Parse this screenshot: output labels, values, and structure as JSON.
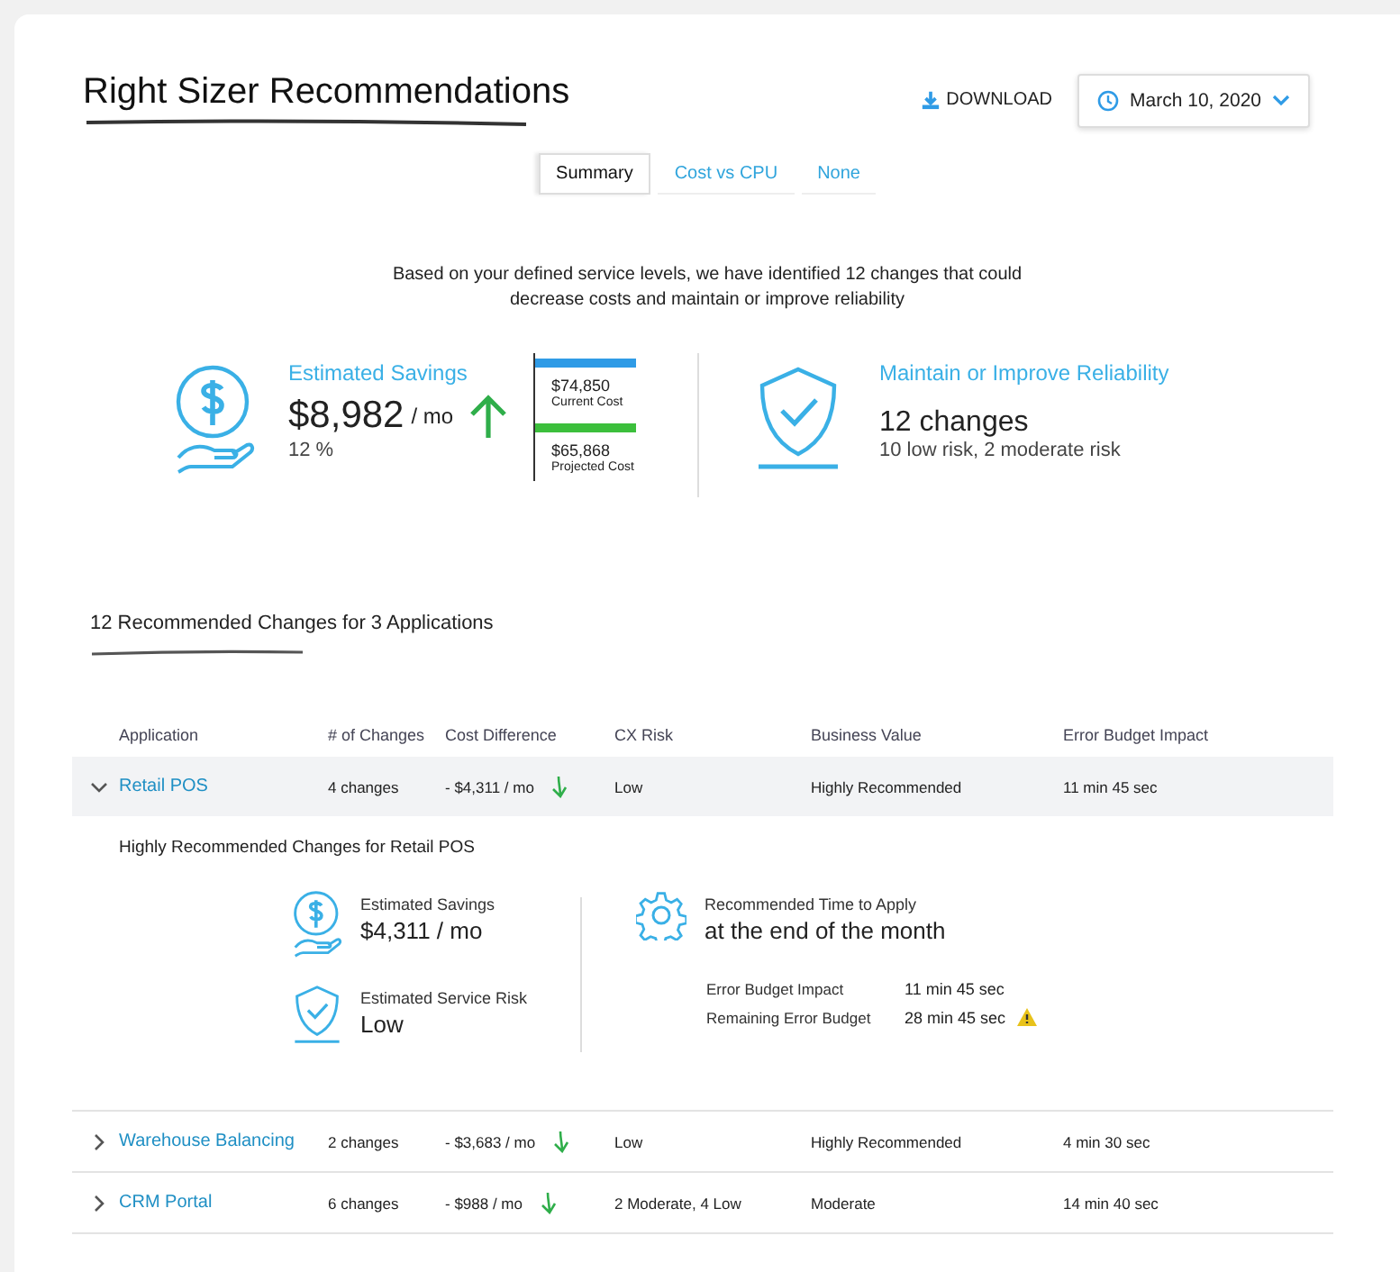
{
  "title": "Right Sizer Recommendations",
  "download": "DOWNLOAD",
  "date": "March 10, 2020",
  "tabs": [
    {
      "label": "Summary",
      "selected": true
    },
    {
      "label": "Cost vs CPU",
      "selected": false
    },
    {
      "label": "None",
      "selected": false
    }
  ],
  "intro": "Based on your defined service levels, we have identified 12 changes that could decrease costs and maintain or improve reliability",
  "savings": {
    "label": "Estimated Savings",
    "amount": "$8,982",
    "unit": "/ mo",
    "percent": "12 %"
  },
  "costs": [
    {
      "value": "$74,850",
      "label": "Current Cost",
      "color": "#2f9be6"
    },
    {
      "value": "$65,868",
      "label": "Projected Cost",
      "color": "#3cbf3c"
    }
  ],
  "reliability": {
    "label": "Maintain or Improve Reliability",
    "count": "12 changes",
    "detail": "10 low risk, 2 moderate risk"
  },
  "section_title": "12 Recommended Changes for 3 Applications",
  "columns": [
    "Application",
    "# of Changes",
    "Cost Difference",
    "CX Risk",
    "Business Value",
    "Error Budget Impact"
  ],
  "rows": [
    {
      "app": "Retail POS",
      "changes": "4 changes",
      "cost": "- $4,311 / mo",
      "risk": "Low",
      "value": "Highly Recommended",
      "impact": "11 min 45 sec",
      "expanded": true,
      "detail": {
        "title": "Highly Recommended Changes for Retail POS",
        "savings_label": "Estimated Savings",
        "savings": "$4,311 / mo",
        "risk_label": "Estimated Service Risk",
        "risk": "Low",
        "time_label": "Recommended Time to Apply",
        "time": "at the end of the month",
        "metrics": [
          {
            "label": "Error Budget Impact",
            "value": "11 min 45 sec",
            "warning": false
          },
          {
            "label": "Remaining Error Budget",
            "value": "28 min 45 sec",
            "warning": true
          }
        ]
      }
    },
    {
      "app": "Warehouse Balancing",
      "changes": "2 changes",
      "cost": "- $3,683 / mo",
      "risk": "Low",
      "value": "Highly Recommended",
      "impact": "4 min 30 sec",
      "expanded": false
    },
    {
      "app": "CRM Portal",
      "changes": "6 changes",
      "cost": "- $988 / mo",
      "risk": "2 Moderate, 4 Low",
      "value": "Moderate",
      "impact": "14 min 40 sec",
      "expanded": false
    }
  ]
}
